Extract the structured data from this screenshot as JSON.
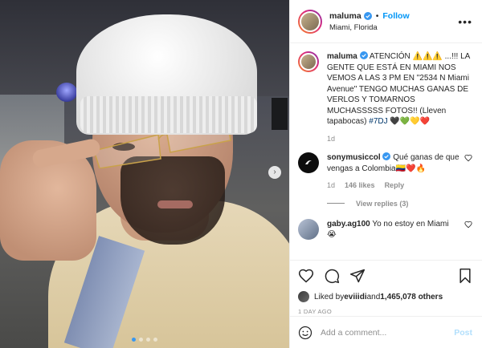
{
  "header": {
    "username": "maluma",
    "separator": "•",
    "follow_label": "Follow",
    "location": "Miami, Florida",
    "more_label": "•••"
  },
  "caption": {
    "username": "maluma",
    "text": "ATENCIÓN ⚠️⚠️⚠️ ...!!! LA GENTE QUE ESTÁ EN MIAMI NOS VEMOS A LAS 3 PM EN \"2534 N Miami Avenue\" TENGO MUCHAS GANAS DE VERLOS Y TOMARNOS MUCHASSSSS FOTOS!! (Lleven tapabocas) ",
    "hashtag": "#7DJ",
    "emoji": " 🖤💚💛❤️",
    "time": "1d"
  },
  "comments": [
    {
      "username": "sonymusiccol",
      "text": "Qué ganas de que vengas a Colombia🇨🇴❤️🔥",
      "time": "1d",
      "likes": "146 likes",
      "reply_label": "Reply",
      "view_replies": "View replies (3)"
    },
    {
      "username": "gaby.ag100",
      "text": "Yo no estoy en Miami 😭"
    }
  ],
  "likes": {
    "prefix": "Liked by ",
    "user": "eviiidi",
    "middle": " and ",
    "count": "1,465,078 others"
  },
  "time_ago": "1 DAY AGO",
  "add_comment": {
    "placeholder": "Add a comment...",
    "post_label": "Post"
  },
  "carousel": {
    "arrow": "›",
    "dots": 4,
    "active_index": 0
  },
  "colors": {
    "accent": "#0095f6",
    "verified": "#3897f0",
    "muted": "#8e8e8e",
    "post_disabled": "#b2dffc"
  }
}
